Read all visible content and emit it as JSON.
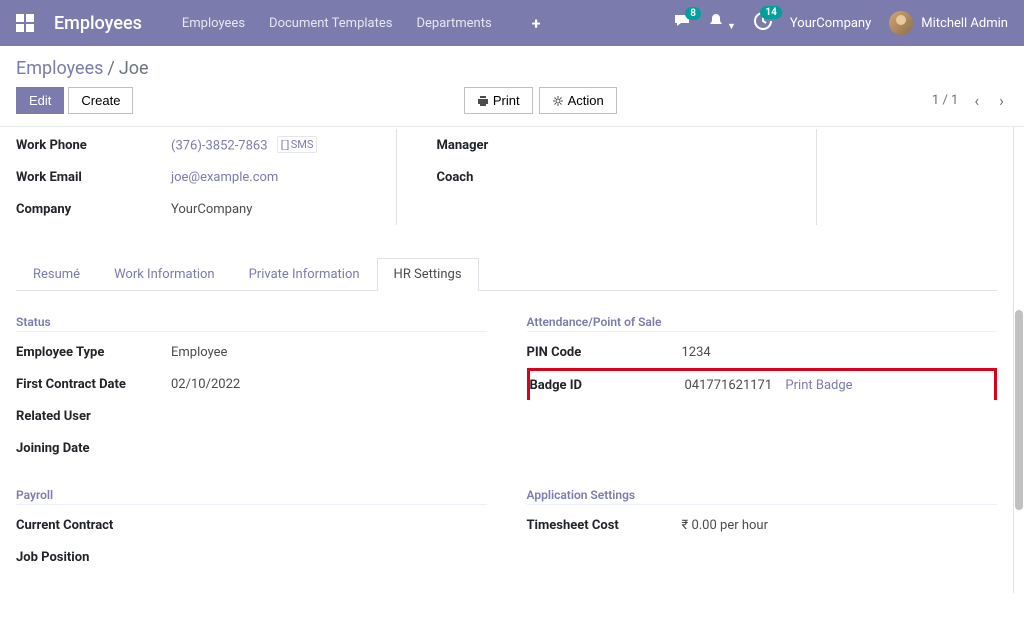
{
  "navbar": {
    "brand": "Employees",
    "menu": [
      "Employees",
      "Document Templates",
      "Departments"
    ],
    "msg_badge": "8",
    "activity_badge": "14",
    "company": "YourCompany",
    "user": "Mitchell Admin"
  },
  "breadcrumb": {
    "root": "Employees",
    "curr": "Joe"
  },
  "buttons": {
    "edit": "Edit",
    "create": "Create",
    "print": "Print",
    "action": "Action"
  },
  "pager": {
    "text": "1 / 1"
  },
  "summary": {
    "work_phone_label": "Work Phone",
    "work_phone": "(376)-3852-7863",
    "sms": "SMS",
    "work_email_label": "Work Email",
    "work_email": "joe@example.com",
    "company_label": "Company",
    "company": "YourCompany",
    "manager_label": "Manager",
    "coach_label": "Coach"
  },
  "tabs": [
    "Resumé",
    "Work Information",
    "Private Information",
    "HR Settings"
  ],
  "hr": {
    "status_title": "Status",
    "emp_type_label": "Employee Type",
    "emp_type": "Employee",
    "first_contract_label": "First Contract Date",
    "first_contract": "02/10/2022",
    "related_user_label": "Related User",
    "joining_date_label": "Joining Date",
    "attendance_title": "Attendance/Point of Sale",
    "pin_label": "PIN Code",
    "pin": "1234",
    "badge_label": "Badge ID",
    "badge_id": "041771621171",
    "print_badge": "Print Badge",
    "payroll_title": "Payroll",
    "curr_contract_label": "Current Contract",
    "job_pos_label": "Job Position",
    "app_settings_title": "Application Settings",
    "timesheet_label": "Timesheet Cost",
    "timesheet_val": "₹ 0.00 per hour"
  }
}
